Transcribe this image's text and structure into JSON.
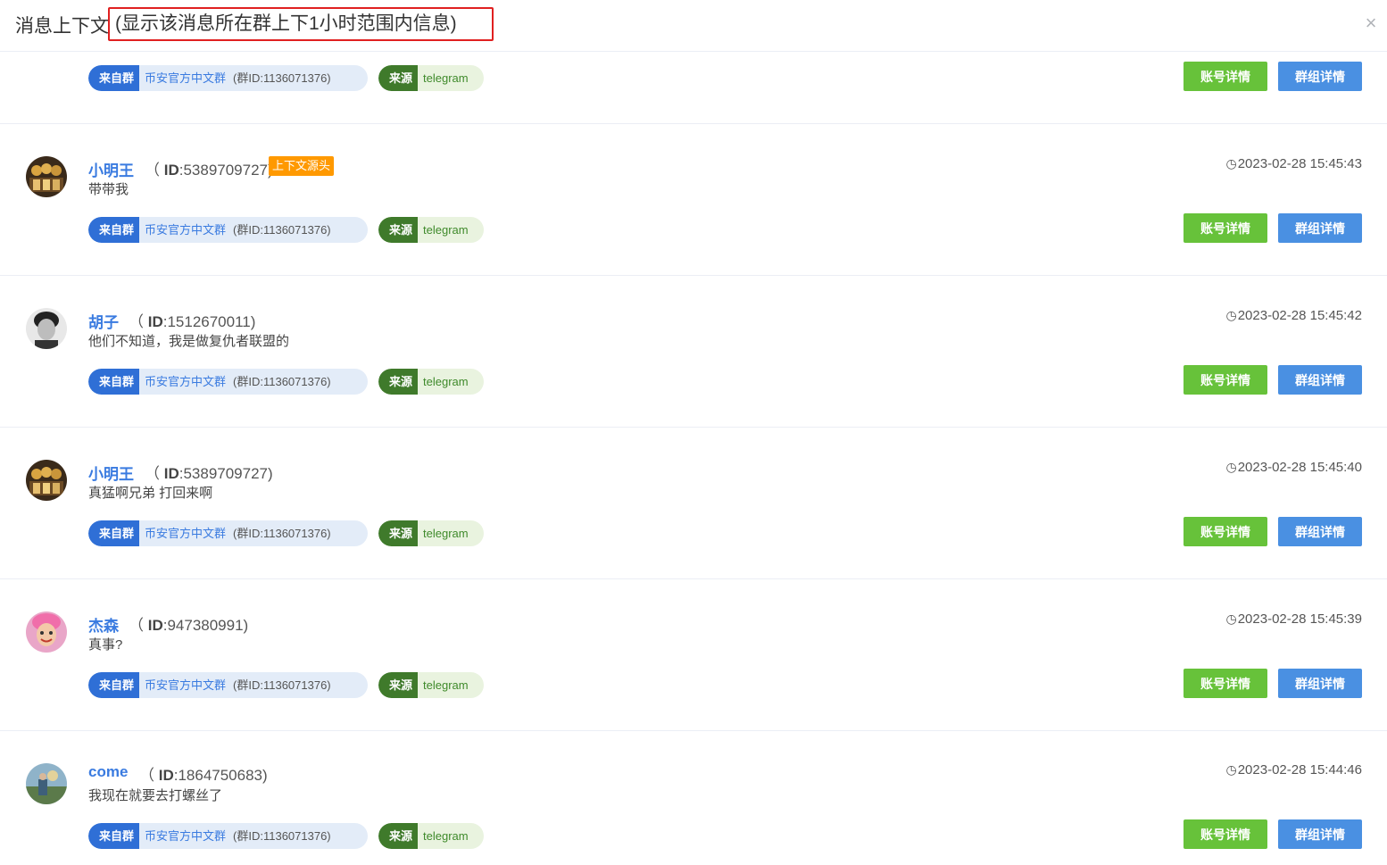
{
  "header": {
    "title": "消息上下文",
    "subtitle": "(显示该消息所在群上下1小时范围内信息)",
    "close_glyph": "×"
  },
  "labels": {
    "from_group": "来自群",
    "source": "来源",
    "account_detail": "账号详情",
    "group_detail": "群组详情",
    "context_origin": "上下文源头",
    "id_prefix": "ID"
  },
  "group": {
    "name": "币安官方中文群",
    "id_text": "(群ID:1136071376)"
  },
  "source_value": "telegram",
  "messages": [
    {
      "name": "小明王",
      "id": "5389709727",
      "id_text": ":5389709727)",
      "content": "带带我",
      "time": "2023-02-28 15:45:43",
      "is_origin": true,
      "avatar": "avatar-group-photo"
    },
    {
      "name": "胡子",
      "id": "1512670011",
      "id_text": ":1512670011)",
      "content": "他们不知道，我是做复仇者联盟的",
      "time": "2023-02-28 15:45:42",
      "is_origin": false,
      "avatar": "avatar-bw-portrait"
    },
    {
      "name": "小明王",
      "id": "5389709727",
      "id_text": ":5389709727)",
      "content": "真猛啊兄弟 打回来啊",
      "time": "2023-02-28 15:45:40",
      "is_origin": false,
      "avatar": "avatar-group-photo"
    },
    {
      "name": "杰森",
      "id": "947380991",
      "id_text": ":947380991)",
      "content": "真事?",
      "time": "2023-02-28 15:45:39",
      "is_origin": false,
      "avatar": "avatar-pink-face"
    },
    {
      "name": "come",
      "id": "1864750683",
      "id_text": ":1864750683)",
      "content": "我现在就要去打螺丝了",
      "time": "2023-02-28 15:44:46",
      "is_origin": false,
      "avatar": "avatar-landscape"
    }
  ],
  "colors": {
    "name_blue": "#3a7be0",
    "group_tag_blue": "#2f6fd6",
    "source_tag_green": "#3f7a2b",
    "account_button": "#67c23a",
    "group_button": "#4a90e2",
    "origin_badge": "#ff9900",
    "highlight_border": "#e02020"
  }
}
